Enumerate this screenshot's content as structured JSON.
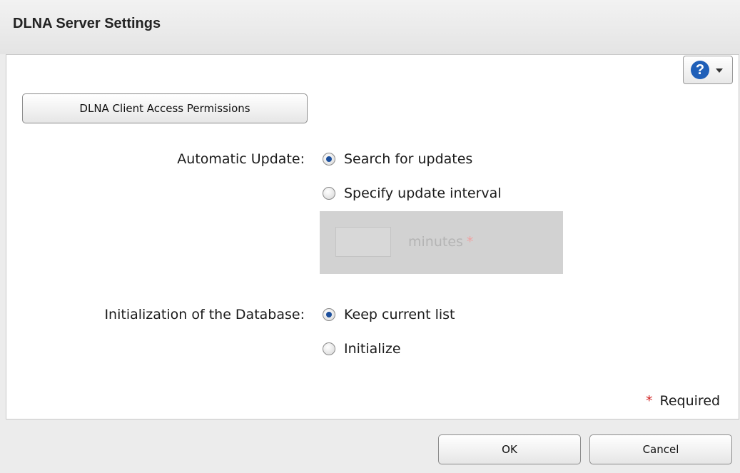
{
  "dialog": {
    "title": "DLNA Server Settings"
  },
  "toolbar": {
    "help_icon": "question-mark-icon",
    "help_glyph": "?"
  },
  "access_button_label": "DLNA Client Access Permissions",
  "automatic_update": {
    "label": "Automatic Update:",
    "options": [
      {
        "label": "Search for updates",
        "checked": true
      },
      {
        "label": "Specify update interval",
        "checked": false
      }
    ],
    "interval": {
      "value": "",
      "unit": "minutes",
      "required_marker": "*",
      "disabled": true
    }
  },
  "database_init": {
    "label": "Initialization of the Database:",
    "options": [
      {
        "label": "Keep current list",
        "checked": true
      },
      {
        "label": "Initialize",
        "checked": false
      }
    ]
  },
  "required_note": {
    "marker": "*",
    "text": "Required"
  },
  "footer": {
    "ok_label": "OK",
    "cancel_label": "Cancel"
  },
  "colors": {
    "accent": "#1c4f9c",
    "required_marker": "#d02020",
    "disabled_panel": "#d2d2d2"
  }
}
